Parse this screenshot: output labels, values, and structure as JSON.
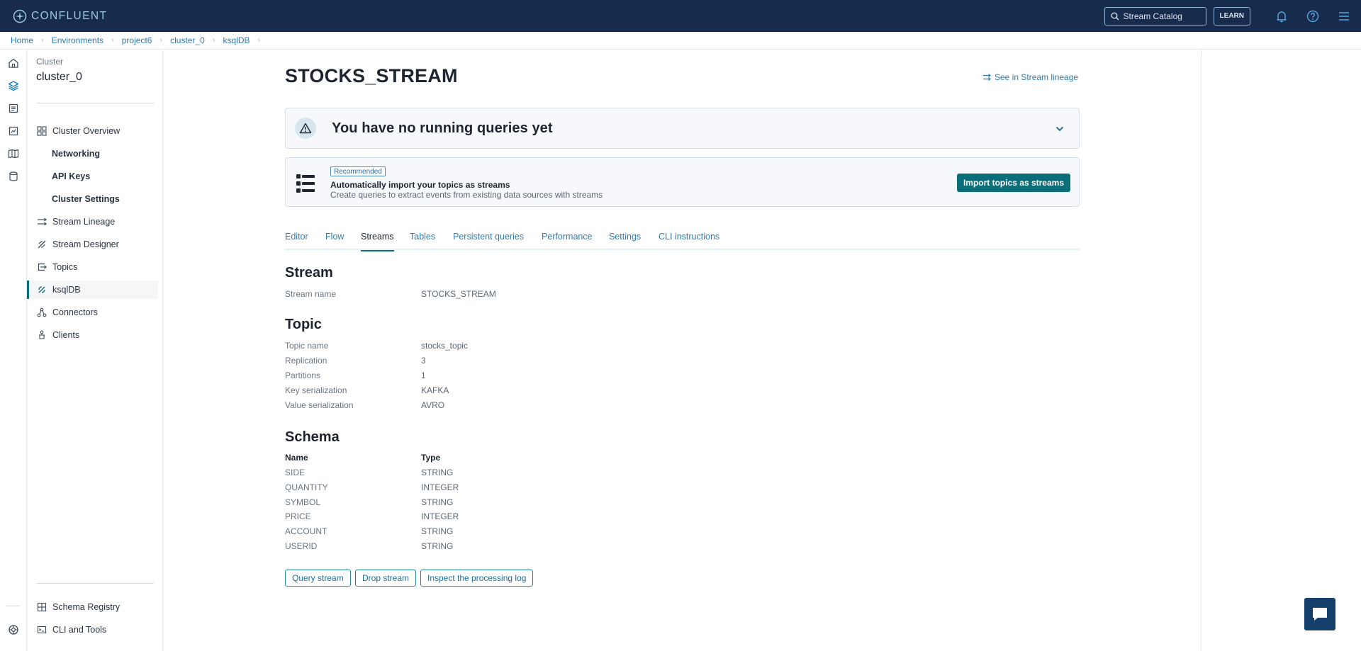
{
  "topbar": {
    "brand": "CONFLUENT",
    "search_placeholder": "Stream Catalog",
    "learn_label": "LEARN"
  },
  "breadcrumb": [
    "Home",
    "Environments",
    "project6",
    "cluster_0",
    "ksqlDB"
  ],
  "sidebar": {
    "subtitle": "Cluster",
    "title": "cluster_0",
    "items": [
      {
        "label": "Cluster Overview",
        "icon": "grid-icon"
      },
      {
        "label": "Networking"
      },
      {
        "label": "API Keys"
      },
      {
        "label": "Cluster Settings"
      },
      {
        "label": "Stream Lineage",
        "icon": "lineage-icon"
      },
      {
        "label": "Stream Designer",
        "icon": "designer-icon"
      },
      {
        "label": "Topics",
        "icon": "topics-icon"
      },
      {
        "label": "ksqlDB",
        "icon": "ksqldb-icon",
        "active": true
      },
      {
        "label": "Connectors",
        "icon": "connectors-icon"
      },
      {
        "label": "Clients",
        "icon": "clients-icon"
      }
    ],
    "bottom_items": [
      {
        "label": "Schema Registry",
        "icon": "schema-registry-icon"
      },
      {
        "label": "CLI and Tools",
        "icon": "cli-icon"
      }
    ]
  },
  "main": {
    "title": "STOCKS_STREAM",
    "lineage_link": "See in Stream lineage",
    "no_queries": "You have no running queries yet",
    "recommend": {
      "badge": "Recommended",
      "title": "Automatically import your topics as streams",
      "desc": "Create queries to extract events from existing data sources with streams",
      "button": "Import topics as streams"
    },
    "tabs": [
      "Editor",
      "Flow",
      "Streams",
      "Tables",
      "Persistent queries",
      "Performance",
      "Settings",
      "CLI instructions"
    ],
    "active_tab": "Streams",
    "stream_section": {
      "heading": "Stream",
      "rows": [
        {
          "label": "Stream name",
          "value": "STOCKS_STREAM"
        }
      ]
    },
    "topic_section": {
      "heading": "Topic",
      "rows": [
        {
          "label": "Topic name",
          "value": "stocks_topic"
        },
        {
          "label": "Replication",
          "value": "3"
        },
        {
          "label": "Partitions",
          "value": "1"
        },
        {
          "label": "Key serialization",
          "value": "KAFKA"
        },
        {
          "label": "Value serialization",
          "value": "AVRO"
        }
      ]
    },
    "schema_section": {
      "heading": "Schema",
      "col_name": "Name",
      "col_type": "Type",
      "rows": [
        {
          "name": "SIDE",
          "type": "STRING"
        },
        {
          "name": "QUANTITY",
          "type": "INTEGER"
        },
        {
          "name": "SYMBOL",
          "type": "STRING"
        },
        {
          "name": "PRICE",
          "type": "INTEGER"
        },
        {
          "name": "ACCOUNT",
          "type": "STRING"
        },
        {
          "name": "USERID",
          "type": "STRING"
        }
      ]
    },
    "actions": [
      "Query stream",
      "Drop stream",
      "Inspect the processing log"
    ]
  }
}
